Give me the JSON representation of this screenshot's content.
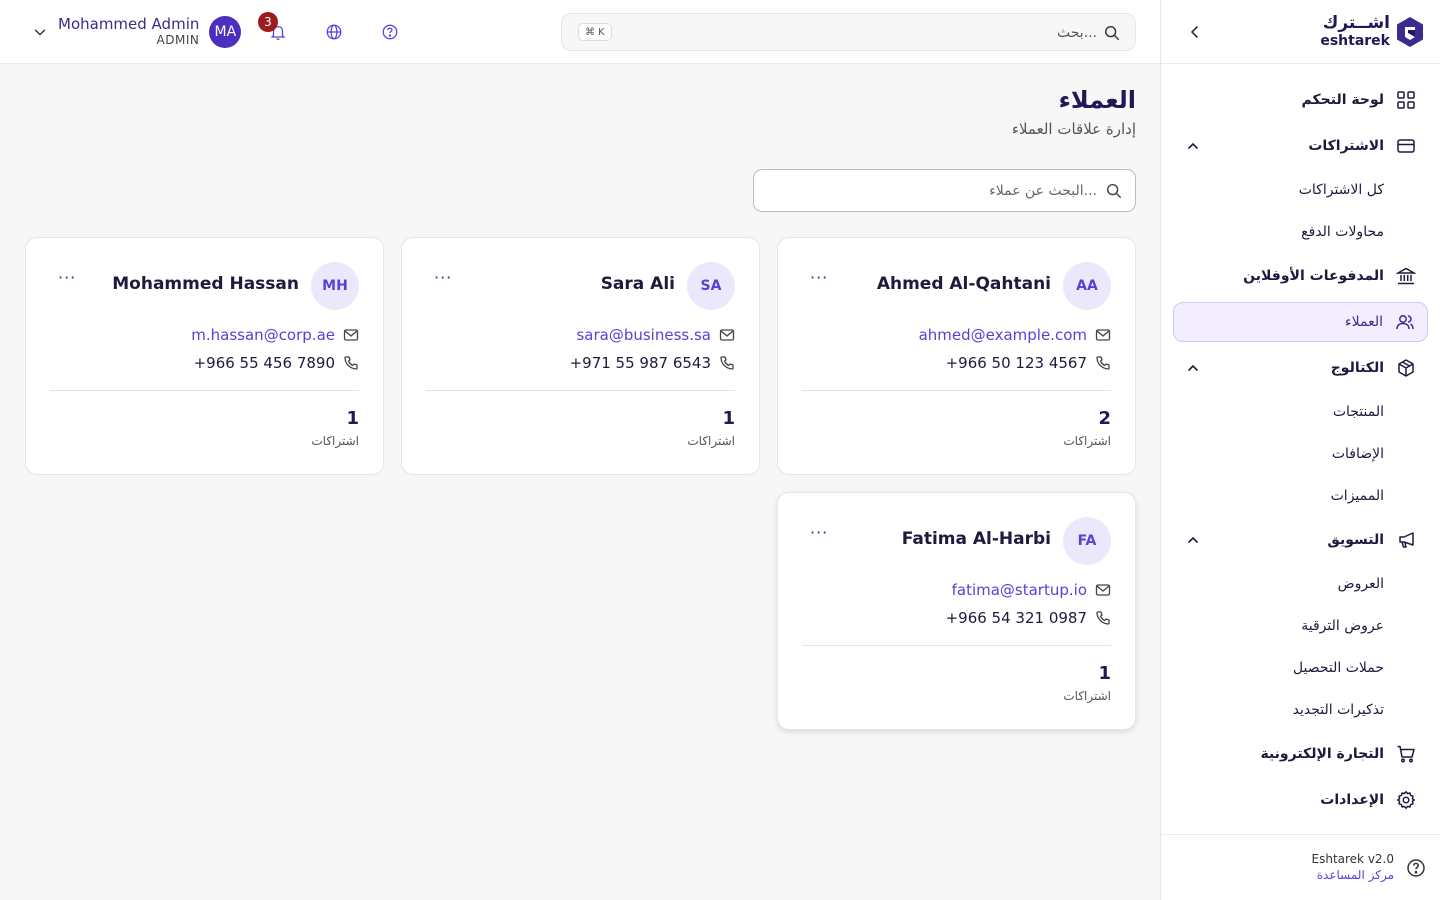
{
  "brand": {
    "name_ar": "اشــترك",
    "name_en": "eshtarek"
  },
  "colors": {
    "accent": "#5b3fd6",
    "brand_dark": "#1f1a55",
    "badge": "#9b1c1c",
    "active_bg": "#f2eeff"
  },
  "topbar": {
    "search_placeholder": "بحث...",
    "shortcut": "⌘ K",
    "notification_count": "3",
    "user": {
      "name": "Mohammed Admin",
      "role": "ADMIN",
      "initials": "MA"
    }
  },
  "sidebar": {
    "items": [
      {
        "label": "لوحة التحكم",
        "icon": "dashboard-icon"
      },
      {
        "label": "الاشتراكات",
        "icon": "credit-card-icon"
      },
      {
        "label": "كل الاشتراكات"
      },
      {
        "label": "محاولات الدفع"
      },
      {
        "label": "المدفوعات الأوفلاين",
        "icon": "bank-icon"
      },
      {
        "label": "العملاء",
        "icon": "users-icon"
      },
      {
        "label": "الكتالوج",
        "icon": "box-icon"
      },
      {
        "label": "المنتجات"
      },
      {
        "label": "الإضافات"
      },
      {
        "label": "المميزات"
      },
      {
        "label": "التسويق",
        "icon": "megaphone-icon"
      },
      {
        "label": "العروض"
      },
      {
        "label": "عروض الترقية"
      },
      {
        "label": "حملات التحصيل"
      },
      {
        "label": "تذكيرات التجديد"
      },
      {
        "label": "التجارة الإلكترونية",
        "icon": "cart-icon"
      },
      {
        "label": "الإعدادات",
        "icon": "settings-icon"
      }
    ],
    "footer": {
      "version": "Eshtarek v2.0",
      "help_link": "مركز المساعدة"
    }
  },
  "main": {
    "title": "العملاء",
    "subtitle": "إدارة علاقات العملاء",
    "search_placeholder": "البحث عن عملاء...",
    "customers": [
      {
        "initials": "AA",
        "name": "Ahmed Al-Qahtani",
        "email": "ahmed@example.com",
        "phone": "+966 50 123 4567",
        "subscriptions": "2",
        "subscriptions_label": "اشتراكات",
        "more": "···"
      },
      {
        "initials": "SA",
        "name": "Sara Ali",
        "email": "sara@business.sa",
        "phone": "+971 55 987 6543",
        "subscriptions": "1",
        "subscriptions_label": "اشتراكات",
        "more": "···"
      },
      {
        "initials": "MH",
        "name": "Mohammed Hassan",
        "email": "m.hassan@corp.ae",
        "phone": "+966 55 456 7890",
        "subscriptions": "1",
        "subscriptions_label": "اشتراكات",
        "more": "···"
      },
      {
        "initials": "FA",
        "name": "Fatima Al-Harbi",
        "email": "fatima@startup.io",
        "phone": "+966 54 321 0987",
        "subscriptions": "1",
        "subscriptions_label": "اشتراكات",
        "more": "···"
      }
    ]
  }
}
